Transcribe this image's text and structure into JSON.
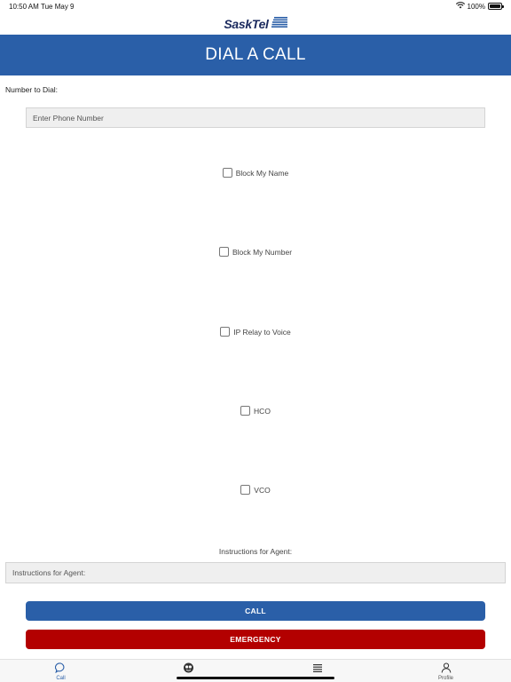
{
  "status_bar": {
    "time": "10:50 AM",
    "date": "Tue May 9",
    "battery": "100%"
  },
  "logo": {
    "text": "SaskTel"
  },
  "header": {
    "title": "DIAL A CALL"
  },
  "form": {
    "number_label": "Number to Dial:",
    "number_placeholder": "Enter Phone Number",
    "options": [
      {
        "label": "Block My Name",
        "checked": false
      },
      {
        "label": "Block My Number",
        "checked": false
      },
      {
        "label": "IP Relay to Voice",
        "checked": false
      },
      {
        "label": "HCO",
        "checked": false
      },
      {
        "label": "VCO",
        "checked": false
      }
    ],
    "instructions_label": "Instructions for Agent:",
    "instructions_placeholder": "Instructions for Agent:"
  },
  "buttons": {
    "call": "CALL",
    "emergency": "EMERGENCY"
  },
  "tabbar": {
    "tabs": [
      {
        "label": "Call",
        "icon": "chat-bubble-icon",
        "active": true
      },
      {
        "label": "",
        "icon": "faces-icon",
        "active": false
      },
      {
        "label": "",
        "icon": "list-icon",
        "active": false
      },
      {
        "label": "Profile",
        "icon": "person-icon",
        "active": false
      }
    ]
  },
  "colors": {
    "brand_blue": "#2a5fa8",
    "emergency_red": "#b30000",
    "logo_navy": "#1b2a5e"
  }
}
